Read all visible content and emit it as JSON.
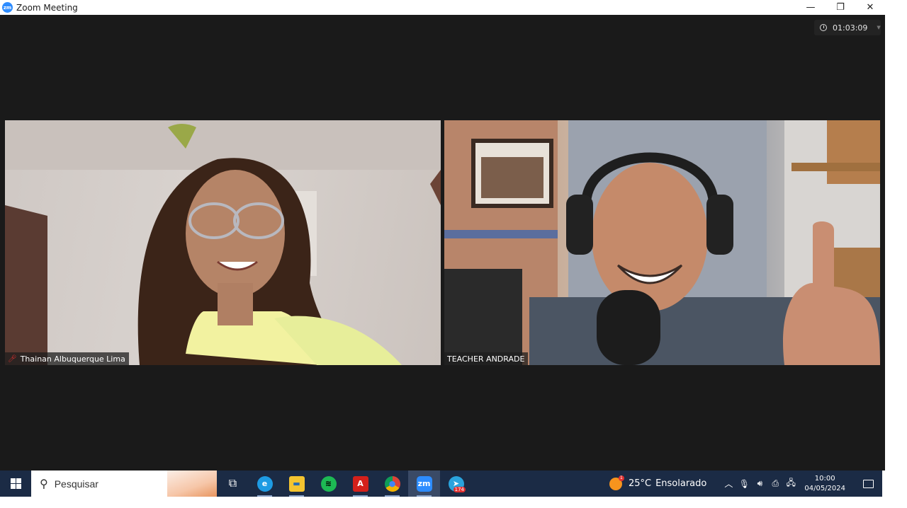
{
  "window": {
    "title": "Zoom Meeting",
    "app_icon_label": "zm",
    "controls": {
      "minimize": "—",
      "restore": "❐",
      "close": "✕"
    }
  },
  "meeting": {
    "timer": "01:03:09",
    "participants": [
      {
        "name": "Thainan Albuquerque Lima",
        "muted": true
      },
      {
        "name": "TEACHER ANDRADE",
        "muted": false
      }
    ]
  },
  "taskbar": {
    "search_placeholder": "Pesquisar",
    "apps": [
      {
        "name": "task-view",
        "glyph": "⧉"
      },
      {
        "name": "edge",
        "glyph": "e",
        "color": "#1e9be3"
      },
      {
        "name": "file-explorer",
        "glyph": "▬",
        "color": "#f4c430"
      },
      {
        "name": "spotify",
        "glyph": "≋",
        "color": "#1db954"
      },
      {
        "name": "acrobat",
        "glyph": "A",
        "color": "#d4201b"
      },
      {
        "name": "chrome",
        "glyph": "●",
        "color": "#db4437"
      },
      {
        "name": "zoom",
        "glyph": "zm",
        "color": "#2d8cff"
      },
      {
        "name": "telegram",
        "glyph": "➤",
        "color": "#2aa3dd",
        "badge": "174"
      }
    ],
    "weather": {
      "temp": "25°C",
      "condition": "Ensolarado",
      "alert": "1"
    },
    "time": "10:00",
    "date": "04/05/2024"
  }
}
